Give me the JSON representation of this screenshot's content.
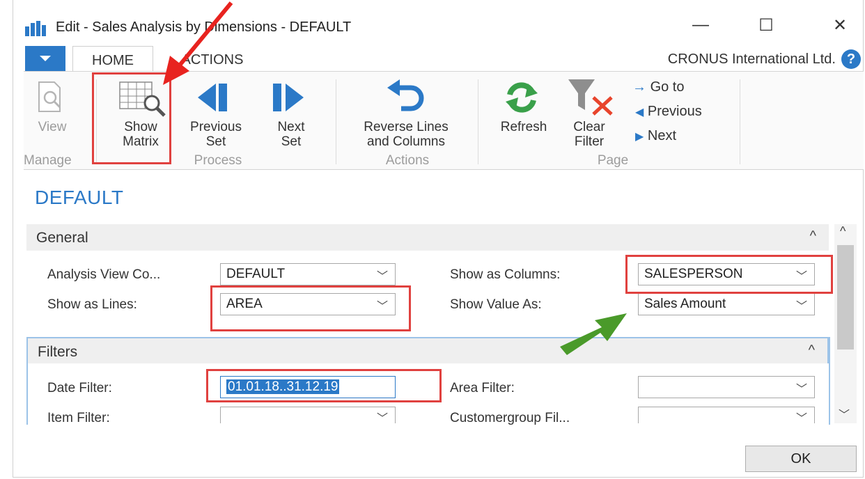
{
  "window": {
    "title": "Edit - Sales Analysis by Dimensions - DEFAULT",
    "controls": {
      "minimize": "—",
      "maximize": "☐",
      "close": "✕"
    }
  },
  "ribbon": {
    "tabs": [
      "HOME",
      "ACTIONS"
    ],
    "company": "CRONUS International Ltd.",
    "help": "?",
    "buttons": {
      "view": "View",
      "show_matrix": [
        "Show",
        "Matrix"
      ],
      "previous_set": [
        "Previous",
        "Set"
      ],
      "next_set": [
        "Next",
        "Set"
      ],
      "reverse": [
        "Reverse Lines",
        "and Columns"
      ],
      "refresh": "Refresh",
      "clear_filter": [
        "Clear",
        "Filter"
      ],
      "go_to": "Go to",
      "previous": "Previous",
      "next": "Next"
    },
    "groups": {
      "manage": "Manage",
      "process": "Process",
      "actions": "Actions",
      "page": "Page"
    }
  },
  "page_title": "DEFAULT",
  "general": {
    "title": "General",
    "analysis_view_label": "Analysis View Co...",
    "analysis_view_value": "DEFAULT",
    "show_as_lines_label": "Show as Lines:",
    "show_as_lines_value": "AREA",
    "show_as_columns_label": "Show as Columns:",
    "show_as_columns_value": "SALESPERSON",
    "show_value_as_label": "Show Value As:",
    "show_value_as_value": "Sales Amount"
  },
  "filters": {
    "title": "Filters",
    "date_filter_label": "Date Filter:",
    "date_filter_value": "01.01.18..31.12.19",
    "item_filter_label": "Item Filter:",
    "item_filter_value": "",
    "area_filter_label": "Area Filter:",
    "area_filter_value": "",
    "customergroup_label": "Customergroup Fil...",
    "customergroup_value": ""
  },
  "ok_label": "OK",
  "colors": {
    "accent": "#2b79c7",
    "highlight_box": "#e0413f",
    "annotation_arrow_red": "#e8231f",
    "annotation_arrow_green": "#4a9a2a",
    "refresh_icon": "#3aa04a"
  }
}
